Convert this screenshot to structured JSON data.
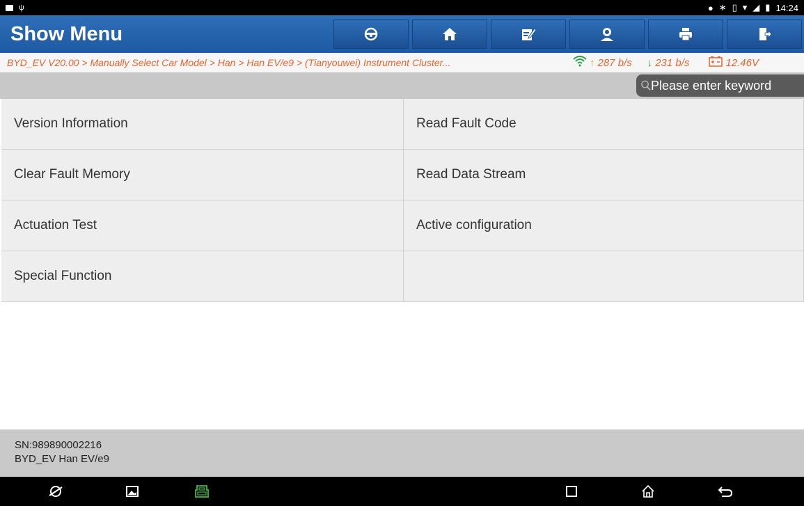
{
  "status_bar": {
    "time": "14:24"
  },
  "header": {
    "title": "Show Menu"
  },
  "toolbar": {
    "buttons": [
      {
        "name": "steering-wheel-icon"
      },
      {
        "name": "home-icon"
      },
      {
        "name": "edit-icon"
      },
      {
        "name": "user-icon"
      },
      {
        "name": "print-icon"
      },
      {
        "name": "exit-icon"
      }
    ]
  },
  "breadcrumb": {
    "path": "BYD_EV V20.00 > Manually Select Car Model > Han > Han EV/e9 > (Tianyouwei) Instrument Cluster...",
    "upload": "287 b/s",
    "download": "231 b/s",
    "voltage": "12.46V",
    "upload_arrow": "↑",
    "download_arrow": "↓"
  },
  "search": {
    "placeholder": "Please enter keyword"
  },
  "menu": {
    "items": [
      "Version Information",
      "Read Fault Code",
      "Clear Fault Memory",
      "Read Data Stream",
      "Actuation Test",
      "Active configuration",
      "Special Function"
    ]
  },
  "footer": {
    "sn": "SN:989890002216",
    "vehicle": "BYD_EV Han EV/e9"
  },
  "colors": {
    "header": "#2566ad",
    "breadcrumb_text": "#e8652c",
    "upload": "#f39b1a",
    "download": "#2ea043"
  }
}
